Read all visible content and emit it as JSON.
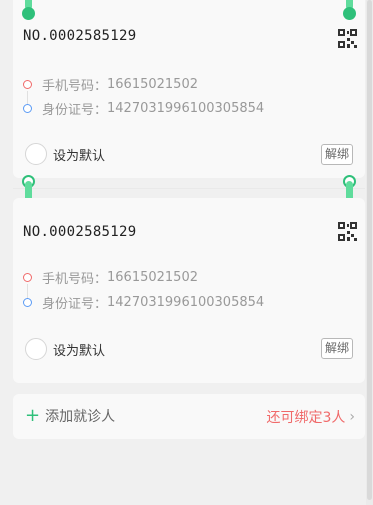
{
  "patients": [
    {
      "card_no": "NO.0002585129",
      "phone_label": "手机号码：",
      "phone": "16615021502",
      "id_label": "身份证号：",
      "id_number": "142703199610030585 4",
      "default_label": "设为默认",
      "unbind_label": "解绑"
    },
    {
      "card_no": "NO.0002585129",
      "phone_label": "手机号码：",
      "phone": "16615021502",
      "id_label": "身份证号：",
      "id_number": "1427031996100305854",
      "default_label": "设为默认",
      "unbind_label": "解绑"
    }
  ],
  "add": {
    "label": "添加就诊人",
    "remaining": "还可绑定3人",
    "plus_icon": "plus-icon",
    "chevron_icon": "chevron-right-icon"
  },
  "colors": {
    "accent_green": "#2fc07a",
    "warn_red": "#f06a6a",
    "info_blue": "#5b9bf5"
  }
}
